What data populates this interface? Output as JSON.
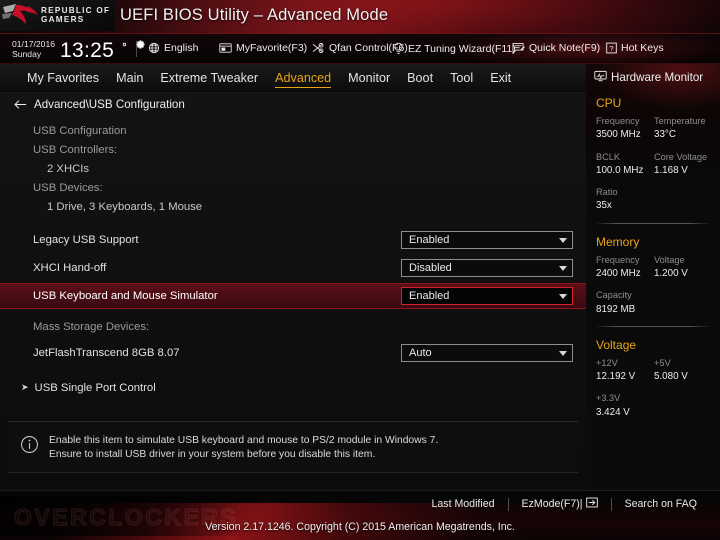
{
  "titlebar": {
    "logo_line1": "REPUBLIC OF",
    "logo_line2": "GAMERS",
    "logo_icon": "rog-eye-logo",
    "title": "UEFI BIOS Utility – Advanced Mode"
  },
  "toolbar": {
    "date": "01/17/2016",
    "weekday": "Sunday",
    "time": "13:25",
    "gear_icon": "gear-icon",
    "items": [
      {
        "label": "English",
        "icon": "globe-icon"
      },
      {
        "label": "MyFavorite(F3)",
        "icon": "favorite-window-icon"
      },
      {
        "label": "Qfan Control(F6)",
        "icon": "fan-icon"
      },
      {
        "label": "EZ Tuning Wizard(F11)",
        "icon": "lightbulb-icon"
      },
      {
        "label": "Quick Note(F9)",
        "icon": "note-icon"
      },
      {
        "label": "Hot Keys",
        "icon": "question-box-icon"
      }
    ]
  },
  "nav": {
    "tabs": [
      {
        "label": "My Favorites",
        "active": false
      },
      {
        "label": "Main",
        "active": false
      },
      {
        "label": "Extreme Tweaker",
        "active": false
      },
      {
        "label": "Advanced",
        "active": true
      },
      {
        "label": "Monitor",
        "active": false
      },
      {
        "label": "Boot",
        "active": false
      },
      {
        "label": "Tool",
        "active": false
      },
      {
        "label": "Exit",
        "active": false
      }
    ],
    "active_color": "#e8a317"
  },
  "content": {
    "breadcrumb": "Advanced\\USB Configuration",
    "back_icon": "back-arrow-icon",
    "rows": [
      {
        "type": "section",
        "label": "USB Configuration"
      },
      {
        "type": "section",
        "label": "USB Controllers:"
      },
      {
        "type": "value",
        "label": "2 XHCIs",
        "indent": true
      },
      {
        "type": "section",
        "label": "USB Devices:"
      },
      {
        "type": "value",
        "label": "1 Drive, 3 Keyboards, 1 Mouse",
        "indent": true
      },
      {
        "type": "spacer"
      },
      {
        "type": "setting",
        "label": "Legacy USB Support",
        "value": "Enabled",
        "highlight": false
      },
      {
        "type": "setting",
        "label": "XHCI Hand-off",
        "value": "Disabled",
        "highlight": false
      },
      {
        "type": "setting",
        "label": "USB Keyboard and Mouse Simulator",
        "value": "Enabled",
        "highlight": true
      },
      {
        "type": "section",
        "label": "Mass Storage Devices:"
      },
      {
        "type": "setting",
        "label": "JetFlashTranscend 8GB 8.07",
        "value": "Auto",
        "highlight": false
      },
      {
        "type": "submenu",
        "label": "USB Single Port Control",
        "arrow": "submenu-arrow-icon"
      }
    ],
    "help": {
      "icon": "info-icon",
      "line1": "Enable this item to simulate USB keyboard and mouse to PS/2 module in Windows 7.",
      "line2": "Ensure to install USB driver in your system before you disable this item."
    }
  },
  "sidebar": {
    "title": "Hardware Monitor",
    "title_icon": "monitor-icon",
    "groups": [
      {
        "heading": "CPU",
        "pairs": [
          [
            {
              "key": "Frequency",
              "value": "3500 MHz"
            },
            {
              "key": "Temperature",
              "value": "33°C"
            }
          ],
          [
            {
              "key": "BCLK",
              "value": "100.0 MHz"
            },
            {
              "key": "Core Voltage",
              "value": "1.168 V"
            }
          ],
          [
            {
              "key": "Ratio",
              "value": "35x"
            }
          ]
        ]
      },
      {
        "heading": "Memory",
        "pairs": [
          [
            {
              "key": "Frequency",
              "value": "2400 MHz"
            },
            {
              "key": "Voltage",
              "value": "1.200 V"
            }
          ],
          [
            {
              "key": "Capacity",
              "value": "8192 MB"
            }
          ]
        ]
      },
      {
        "heading": "Voltage",
        "pairs": [
          [
            {
              "key": "+12V",
              "value": "12.192 V"
            },
            {
              "key": "+5V",
              "value": "5.080 V"
            }
          ],
          [
            {
              "key": "+3.3V",
              "value": "3.424 V"
            }
          ]
        ]
      }
    ]
  },
  "bottombar": {
    "watermark": "OVERCLOCKERS",
    "actions": [
      {
        "label": "Last Modified",
        "icon": ""
      },
      {
        "label": "EzMode(F7)|",
        "icon": "enter-arrow-icon"
      },
      {
        "label": "Search on FAQ",
        "icon": ""
      }
    ],
    "copyright": "Version 2.17.1246. Copyright (C) 2015 American Megatrends, Inc."
  }
}
